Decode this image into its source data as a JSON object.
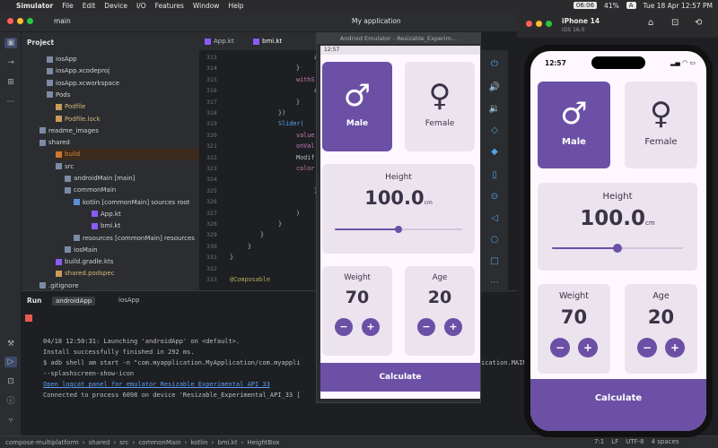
{
  "menubar": {
    "apple": "",
    "app": "Simulator",
    "items": [
      "File",
      "Edit",
      "Device",
      "I/O",
      "Features",
      "Window",
      "Help"
    ],
    "clock": "06:06",
    "battery": "41%",
    "input_lang": "A",
    "datetime": "Tue 18 Apr 12:57 PM"
  },
  "ide": {
    "branch": "main",
    "window_title": "My application",
    "panel_title": "Project",
    "tree": [
      {
        "label": "iosApp",
        "indent": 28
      },
      {
        "label": "iosApp.xcodeproj",
        "indent": 28
      },
      {
        "label": "iosApp.xcworkspace",
        "indent": 28
      },
      {
        "label": "Pods",
        "indent": 28
      },
      {
        "label": "Podfile",
        "indent": 38
      },
      {
        "label": "Podfile.lock",
        "indent": 38
      },
      {
        "label": "readme_images",
        "indent": 20
      },
      {
        "label": "shared",
        "indent": 20
      },
      {
        "label": "build",
        "indent": 38
      },
      {
        "label": "src",
        "indent": 38
      },
      {
        "label": "androidMain [main]",
        "indent": 48
      },
      {
        "label": "commonMain",
        "indent": 48
      },
      {
        "label": "kotlin [commonMain]  sources root",
        "indent": 58
      },
      {
        "label": "App.kt",
        "indent": 78
      },
      {
        "label": "bmi.kt",
        "indent": 78
      },
      {
        "label": "resources [commonMain]  resources",
        "indent": 58
      },
      {
        "label": "iosMain",
        "indent": 48
      },
      {
        "label": "build.gradle.kts",
        "indent": 38
      },
      {
        "label": "shared.podspec",
        "indent": 38
      },
      {
        "label": ".gitignore",
        "indent": 20
      }
    ],
    "tabs": [
      "App.kt",
      "bmi.kt"
    ],
    "gutter": [
      "313",
      "314",
      "315",
      "316",
      "317",
      "318",
      "319",
      "320",
      "321",
      "322",
      "323",
      "324",
      "325",
      "326",
      "327",
      "328",
      "329",
      "330",
      "331",
      "332",
      "333"
    ],
    "code": [
      {
        "text": "a",
        "indent": 94
      },
      {
        "text": "}",
        "indent": 74
      },
      {
        "text": "withS",
        "indent": 74
      },
      {
        "text": "a",
        "indent": 94
      },
      {
        "text": "}",
        "indent": 74
      },
      {
        "text": "})",
        "indent": 54
      },
      {
        "text": "Slider(",
        "indent": 54
      },
      {
        "text": "value",
        "indent": 74
      },
      {
        "text": "onVal",
        "indent": 74
      },
      {
        "text": "Modif",
        "indent": 74
      },
      {
        "text": "color",
        "indent": 74
      },
      {
        "text": "",
        "indent": 94
      },
      {
        "text": "}",
        "indent": 94
      },
      {
        "text": "",
        "indent": 74
      },
      {
        "text": ")",
        "indent": 74
      },
      {
        "text": "}",
        "indent": 54
      },
      {
        "text": "}",
        "indent": 34
      },
      {
        "text": "}",
        "indent": 20
      },
      {
        "text": "}",
        "indent": 0
      },
      {
        "text": "",
        "indent": 0
      },
      {
        "text": "@Composable",
        "indent": 0
      }
    ],
    "run_label": "Run",
    "run_tabs": [
      "androidApp",
      "iosApp"
    ],
    "console": [
      {
        "text": "04/18 12:50:31: Launching 'androidApp' on <default>.",
        "link": false
      },
      {
        "text": "Install successfully finished in 292 ms.",
        "link": false
      },
      {
        "text": "$ adb shell am start -n \"com.myapplication.MyApplication/com.myappli",
        "link": false
      },
      {
        "text": "  --splashscreen-show-icon",
        "link": false
      },
      {
        "text": "Open logcat panel for emulator Resizable Experimental API 33",
        "link": true
      },
      {
        "text": "Connected to process 6098 on device 'Resizable_Experimental_API_33 [",
        "link": false
      }
    ],
    "console_tail": "ication.MAIN -",
    "breadcrumb": [
      "compose-multiplatform",
      "shared",
      "src",
      "commonMain",
      "kotlin",
      "bmi.kt",
      "HeightBox"
    ],
    "status_right": [
      "7:1",
      "LF",
      "UTF-8",
      "4 spaces"
    ]
  },
  "emulator": {
    "title": "Android Emulator - Resizable_Experim...",
    "time": "12:57"
  },
  "simulator": {
    "device": "iPhone 14",
    "os": "iOS 16.0",
    "time": "12:57"
  },
  "bmi": {
    "male": "Male",
    "female": "Female",
    "height_label": "Height",
    "height_value": "100.0",
    "height_unit": "cm",
    "height_slider_fraction": 0.5,
    "weight_label": "Weight",
    "weight_value": "70",
    "age_label": "Age",
    "age_value": "20",
    "minus": "−",
    "plus": "+",
    "calculate": "Calculate",
    "male_symbol": "♂",
    "female_symbol": "♀",
    "accent": "#6b50a6",
    "card_bg": "#ebe3ee"
  }
}
